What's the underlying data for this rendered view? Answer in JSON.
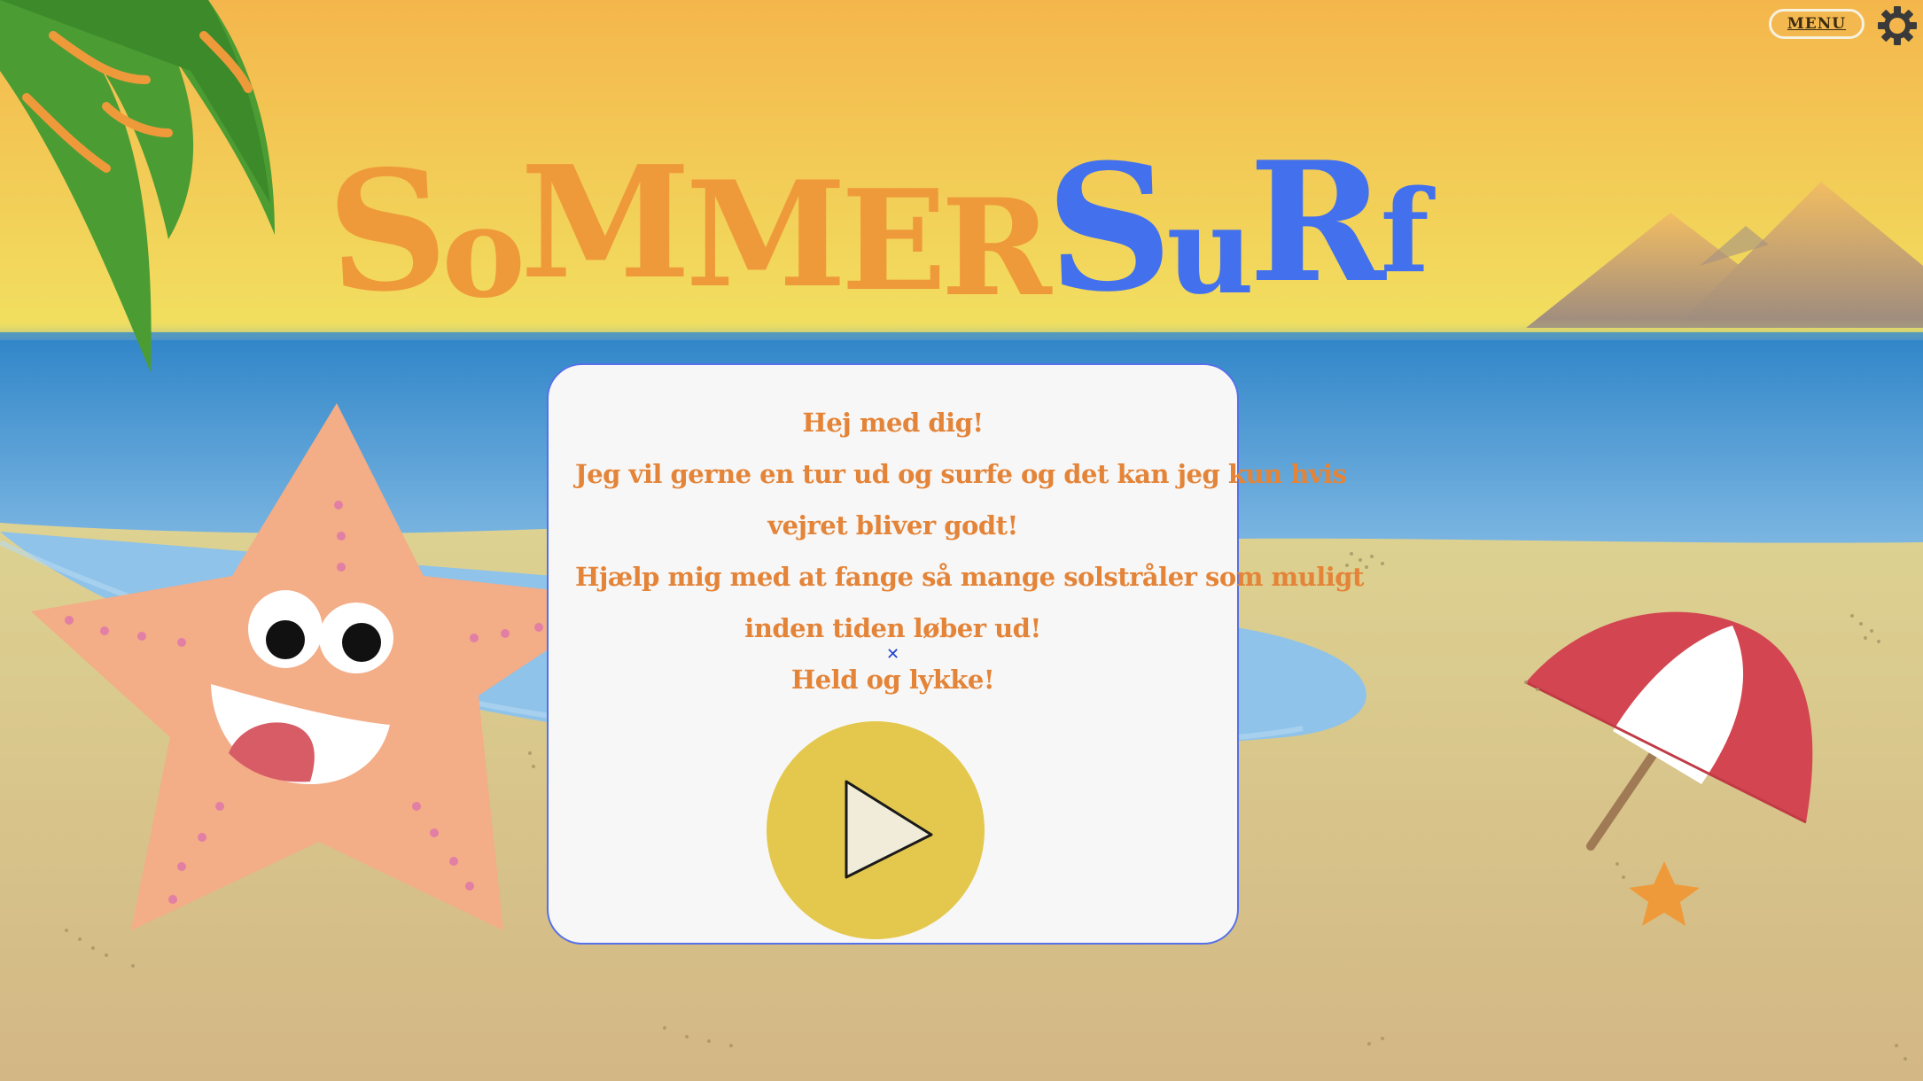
{
  "header": {
    "menu_label": "MENU",
    "settings_icon": "gear-icon"
  },
  "title": {
    "part1": [
      "S",
      "o",
      "M",
      "M",
      "E",
      "R"
    ],
    "part2": [
      "S",
      "u",
      "R",
      "f"
    ],
    "color_part1": "#ef9a3a",
    "color_part2": "#4371ee"
  },
  "dialog": {
    "lines": [
      "Hej med dig!",
      "Jeg vil gerne en tur ud og surfe og det kan jeg kun hvis",
      "vejret bliver godt!",
      "Hjælp mig med at fange så mange solstråler som muligt",
      "inden tiden løber ud!",
      "Held og lykke!"
    ],
    "play_icon": "play-icon"
  },
  "colors": {
    "sky_top": "#f4b64c",
    "sky_bottom": "#f1e060",
    "sea": "#3f8fcd",
    "sand": "#dcd08a",
    "starfish": "#f3ad87",
    "umbrella_red": "#d34651",
    "play_button": "#e4c84d"
  }
}
